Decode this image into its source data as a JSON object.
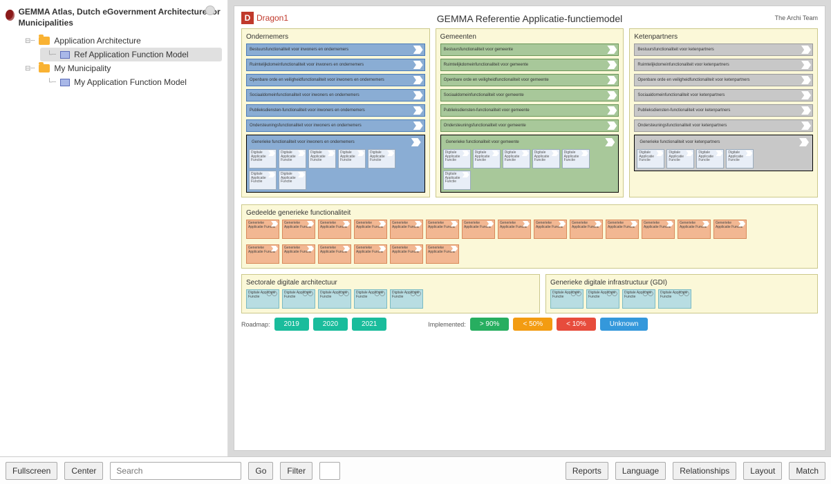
{
  "sidebar": {
    "root_title": "GEMMA Atlas, Dutch eGovernment Architecture for Municipalities",
    "items": [
      {
        "label": "Application Architecture",
        "children": [
          {
            "label": "Ref Application Function Model",
            "selected": true
          }
        ]
      },
      {
        "label": "My Municipality",
        "children": [
          {
            "label": "My Application Function Model"
          }
        ]
      }
    ]
  },
  "header": {
    "logo": "Dragon1",
    "title": "GEMMA Referentie Applicatie-functiemodel",
    "team": "The Archi Team"
  },
  "columns": [
    {
      "title": "Ondernemers",
      "color": "blue",
      "bars": [
        "Bestuursfunctionaliteit voor inwoners en ondernemers",
        "Ruimtelijkdomeinfunctionaliteit voor inwoners en ondernemers",
        "Openbare orde en veiligheidfunctionaliteit voor inwoners en ondernemers",
        "Sociaaldomeinfunctionaliteit voor inwoners en ondernemers",
        "Publieksdiensten-functionaliteit voor inwoners en ondernemers",
        "Ondersteuningsfunctionaliteit voor inwoners en ondernemers"
      ],
      "gen": "Generieke functionaliteit voor inwoners en ondernemers",
      "minis": 7
    },
    {
      "title": "Gemeenten",
      "color": "green",
      "bars": [
        "Bestuursfunctionaliteit voor gemeente",
        "Ruimtelijkdomeinfunctionaliteit voor gemeente",
        "Openbare orde en veiligheidfunctionaliteit voor gemeente",
        "Sociaaldomeinfunctionaliteit voor gemeente",
        "Publieksdiensten-functionaliteit voor gemeente",
        "Ondersteuningsfunctionaliteit voor gemeente"
      ],
      "gen": "Generieke functionaliteit voor gemeente",
      "minis": 6
    },
    {
      "title": "Ketenpartners",
      "color": "gray",
      "bars": [
        "Bestuursfunctionaliteit voor ketenpartners",
        "Ruimtelijkdomeinfunctionaliteit voor ketenpartners",
        "Openbare orde en veiligheidfunctionaliteit voor ketenpartners",
        "Sociaaldomeinfunctionaliteit voor ketenpartners",
        "Publieksdiensten-functionaliteit voor ketenpartners",
        "Ondersteuningsfunctionaliteit voor ketenpartners"
      ],
      "gen": "Generieke functionaliteit voor ketenpartners",
      "minis": 4
    }
  ],
  "mini_label": "Digitale Applicatie Functie",
  "shared": {
    "title": "Gedeelde generieke functionaliteit",
    "label": "Generieke Applicatie Functie",
    "count": 20
  },
  "sectoral": {
    "title": "Sectorale digitale architectuur",
    "label": "Digitale Applicatie Functie",
    "count": 5
  },
  "gdi": {
    "title": "Generieke digitale infrastructuur (GDI)",
    "label": "Digitale Applicatie Functie",
    "count": 4
  },
  "legend": {
    "roadmap_label": "Roadmap:",
    "roadmap": [
      "2019",
      "2020",
      "2021"
    ],
    "impl_label": "Implemented:",
    "impl": [
      {
        "label": "> 90%",
        "cls": "l-green"
      },
      {
        "label": "< 50%",
        "cls": "l-orange"
      },
      {
        "label": "< 10%",
        "cls": "l-red"
      },
      {
        "label": "Unknown",
        "cls": "l-blue"
      }
    ]
  },
  "toolbar": {
    "fullscreen": "Fullscreen",
    "center": "Center",
    "search_ph": "Search",
    "go": "Go",
    "filter": "Filter",
    "reports": "Reports",
    "language": "Language",
    "relationships": "Relationships",
    "layout": "Layout",
    "match": "Match"
  }
}
